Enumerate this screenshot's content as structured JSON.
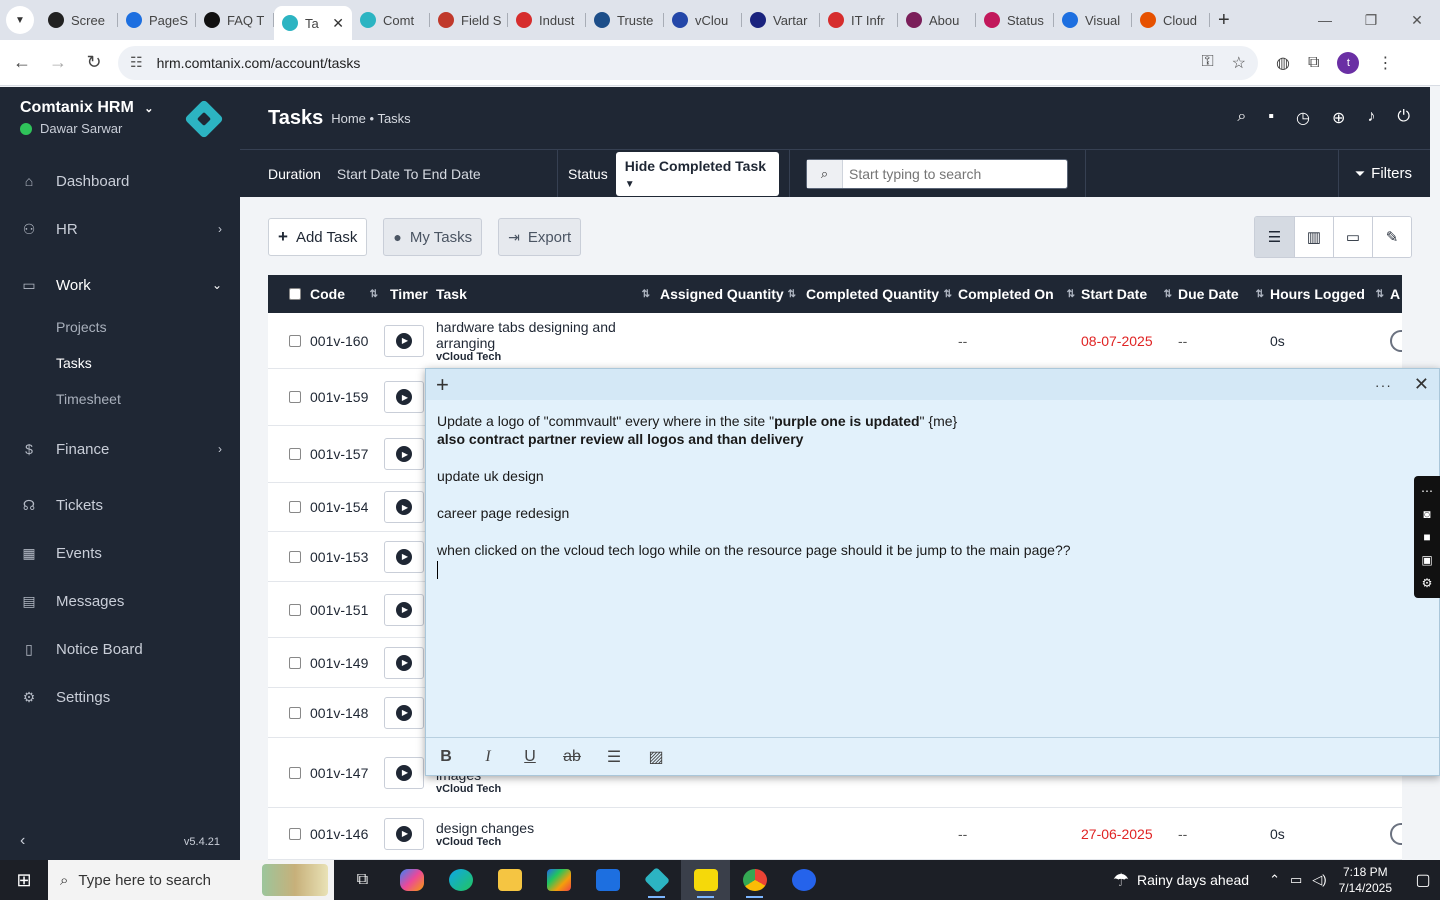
{
  "browser": {
    "tabs": [
      {
        "label": "Scree",
        "color": "#222"
      },
      {
        "label": "PageS",
        "color": "#1d6fe0"
      },
      {
        "label": "FAQ T",
        "color": "#111"
      },
      {
        "label": "Ta",
        "color": "#2cb4c2",
        "active": true
      },
      {
        "label": "Comt",
        "color": "#2cb4c2"
      },
      {
        "label": "Field S",
        "color": "#c0392b"
      },
      {
        "label": "Indust",
        "color": "#d62d2d"
      },
      {
        "label": "Truste",
        "color": "#1d4e89"
      },
      {
        "label": "vClou",
        "color": "#2447a8"
      },
      {
        "label": "Vartar",
        "color": "#1a237e"
      },
      {
        "label": "IT Infr",
        "color": "#d62d2d"
      },
      {
        "label": "Abou",
        "color": "#7b1f5a"
      },
      {
        "label": "Status",
        "color": "#c2185b"
      },
      {
        "label": "Visual",
        "color": "#1d6fe0"
      },
      {
        "label": "Cloud",
        "color": "#e65100"
      }
    ],
    "url": "hrm.comtanix.com/account/tasks",
    "profile_initial": "t"
  },
  "sidebar": {
    "company": "Comtanix HRM",
    "user": "Dawar Sarwar",
    "items": [
      {
        "label": "Dashboard",
        "icon": "home-icon"
      },
      {
        "label": "HR",
        "icon": "users-icon"
      },
      {
        "label": "Work",
        "icon": "briefcase-icon"
      },
      {
        "label": "Finance",
        "icon": "dollar-icon"
      },
      {
        "label": "Tickets",
        "icon": "headset-icon"
      },
      {
        "label": "Events",
        "icon": "calendar-icon"
      },
      {
        "label": "Messages",
        "icon": "message-icon"
      },
      {
        "label": "Notice Board",
        "icon": "clipboard-icon"
      },
      {
        "label": "Settings",
        "icon": "gear-icon"
      }
    ],
    "work_sub": [
      "Projects",
      "Tasks",
      "Timesheet"
    ],
    "version": "v5.4.21"
  },
  "header": {
    "title": "Tasks",
    "breadcrumb": "Home • Tasks"
  },
  "filters": {
    "duration_label": "Duration",
    "duration_value": "Start Date To End Date",
    "status_label": "Status",
    "status_value": "Hide Completed Task",
    "search_placeholder": "Start typing to search",
    "filters_label": "Filters"
  },
  "actions": {
    "add_task": "Add Task",
    "my_tasks": "My Tasks",
    "export": "Export"
  },
  "table": {
    "columns": [
      "Code",
      "Timer",
      "Task",
      "Assigned Quantity",
      "Completed Quantity",
      "Completed On",
      "Start Date",
      "Due Date",
      "Hours Logged",
      "A"
    ],
    "rows": [
      {
        "code": "001v-160",
        "task": "hardware tabs designing and arranging",
        "project": "vCloud Tech",
        "completed_on": "--",
        "start_date": "08-07-2025",
        "due_date": "--",
        "hours": "0s"
      },
      {
        "code": "001v-159"
      },
      {
        "code": "001v-157"
      },
      {
        "code": "001v-154"
      },
      {
        "code": "001v-153"
      },
      {
        "code": "001v-151"
      },
      {
        "code": "001v-149"
      },
      {
        "code": "001v-148"
      },
      {
        "code": "001v-147",
        "task": "some places new animation images",
        "project": "vCloud Tech"
      },
      {
        "code": "001v-146",
        "task": "design changes",
        "project": "vCloud Tech",
        "completed_on": "--",
        "start_date": "27-06-2025",
        "due_date": "--",
        "hours": "0s"
      }
    ]
  },
  "sticky": {
    "line1_a": "Update a logo of \"commvault\" every where in the site \"",
    "line1_bold": "purple one is updated",
    "line1_b": "\" {me}",
    "line2": "also contract partner review all logos and than delivery",
    "line3": "update uk design",
    "line4": "career page redesign",
    "line5": "when clicked on the vcloud tech logo while on the resource page should it be jump to the main page??"
  },
  "taskbar": {
    "search_placeholder": "Type here to search",
    "weather": "Rainy days ahead",
    "time": "7:18 PM",
    "date": "7/14/2025"
  }
}
